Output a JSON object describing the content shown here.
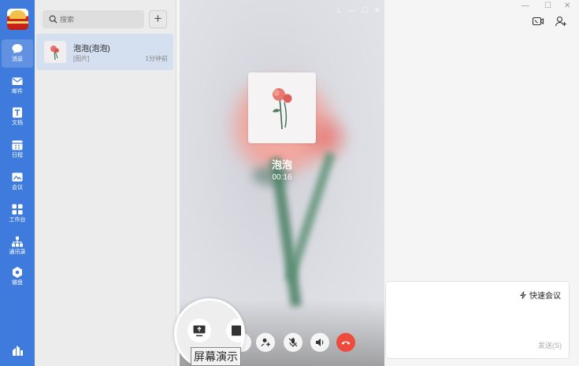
{
  "colors": {
    "rail": "#3f7bdc",
    "active_conv": "#d4dff0",
    "hangup": "#ee4b3e"
  },
  "nav": {
    "items": [
      {
        "label": "消息",
        "icon": "chat-bubble-icon"
      },
      {
        "label": "邮件",
        "icon": "mail-icon"
      },
      {
        "label": "文档",
        "icon": "document-icon"
      },
      {
        "label": "日程",
        "icon": "calendar-icon"
      },
      {
        "label": "会议",
        "icon": "meeting-icon"
      },
      {
        "label": "工作台",
        "icon": "workbench-grid-icon"
      },
      {
        "label": "通讯录",
        "icon": "contacts-tree-icon"
      },
      {
        "label": "微盘",
        "icon": "drive-icon"
      }
    ]
  },
  "search": {
    "placeholder": "搜索"
  },
  "conversations": [
    {
      "name": "泡泡(泡泡)",
      "preview": "[图片]",
      "time": "1分钟前"
    }
  ],
  "call": {
    "caller_name": "泡泡",
    "duration": "00:16",
    "buttons": [
      "screen-share",
      "window-share",
      "add-member",
      "mute",
      "speaker",
      "hang-up"
    ]
  },
  "tooltip": {
    "text": "屏幕演示"
  },
  "composer": {
    "quick_meeting": "快速会议",
    "send": "发送(S)"
  }
}
